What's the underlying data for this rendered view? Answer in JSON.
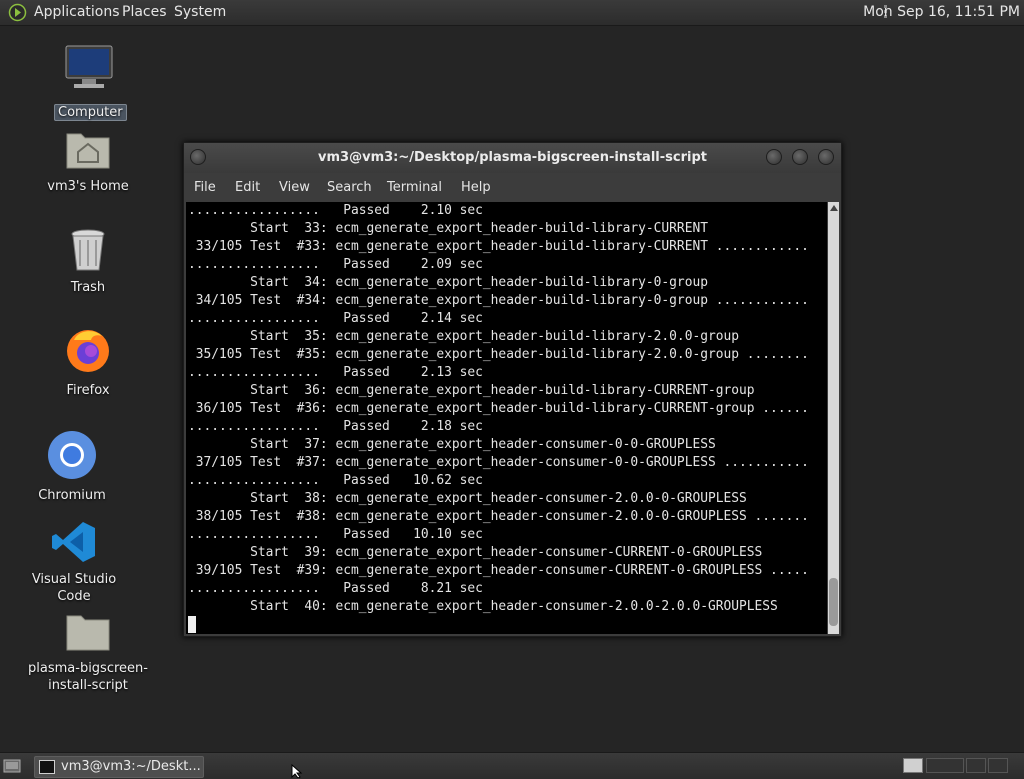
{
  "top_panel": {
    "applications": "Applications",
    "places": "Places",
    "system": "System",
    "clock": "Mon Sep 16, 11:51 PM"
  },
  "desktop_icons": [
    {
      "label": "Computer",
      "icon": "computer-icon"
    },
    {
      "label": "vm3's Home",
      "icon": "home-folder-icon"
    },
    {
      "label": "Trash",
      "icon": "trash-icon"
    },
    {
      "label": "Firefox",
      "icon": "firefox-icon"
    },
    {
      "label": "Chromium",
      "icon": "chromium-icon"
    },
    {
      "label": "Visual Studio Code",
      "icon": "vscode-icon"
    },
    {
      "label": "plasma-bigscreen-install-script",
      "label_line1": "plasma-bigscreen-",
      "label_line2": "install-script",
      "icon": "folder-icon"
    }
  ],
  "terminal": {
    "title": "vm3@vm3:~/Desktop/plasma-bigscreen-install-script",
    "menu": [
      "File",
      "Edit",
      "View",
      "Search",
      "Terminal",
      "Help"
    ],
    "lines": [
      ".................   Passed    2.10 sec",
      "        Start  33: ecm_generate_export_header-build-library-CURRENT",
      " 33/105 Test  #33: ecm_generate_export_header-build-library-CURRENT ............",
      ".................   Passed    2.09 sec",
      "        Start  34: ecm_generate_export_header-build-library-0-group",
      " 34/105 Test  #34: ecm_generate_export_header-build-library-0-group ............",
      ".................   Passed    2.14 sec",
      "        Start  35: ecm_generate_export_header-build-library-2.0.0-group",
      " 35/105 Test  #35: ecm_generate_export_header-build-library-2.0.0-group ........",
      ".................   Passed    2.13 sec",
      "        Start  36: ecm_generate_export_header-build-library-CURRENT-group",
      " 36/105 Test  #36: ecm_generate_export_header-build-library-CURRENT-group ......",
      ".................   Passed    2.18 sec",
      "        Start  37: ecm_generate_export_header-consumer-0-0-GROUPLESS",
      " 37/105 Test  #37: ecm_generate_export_header-consumer-0-0-GROUPLESS ...........",
      ".................   Passed   10.62 sec",
      "        Start  38: ecm_generate_export_header-consumer-2.0.0-0-GROUPLESS",
      " 38/105 Test  #38: ecm_generate_export_header-consumer-2.0.0-0-GROUPLESS .......",
      ".................   Passed   10.10 sec",
      "        Start  39: ecm_generate_export_header-consumer-CURRENT-0-GROUPLESS",
      " 39/105 Test  #39: ecm_generate_export_header-consumer-CURRENT-0-GROUPLESS .....",
      ".................   Passed    8.21 sec",
      "        Start  40: ecm_generate_export_header-consumer-2.0.0-2.0.0-GROUPLESS"
    ]
  },
  "taskbar": {
    "task_label": "vm3@vm3:~/Deskt..."
  }
}
